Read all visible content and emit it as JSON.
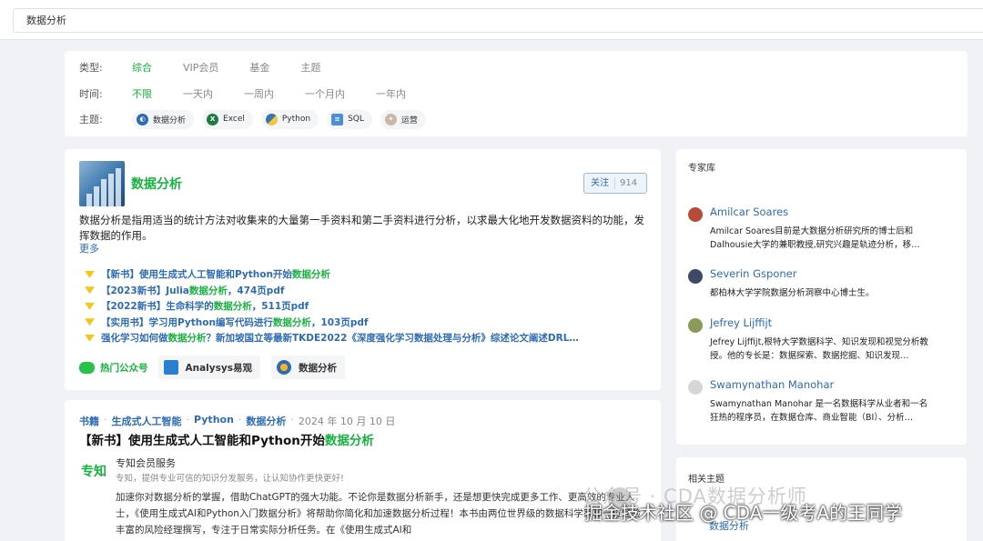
{
  "search": {
    "value": "数据分析"
  },
  "filters": {
    "type_label": "类型:",
    "type_options": [
      "综合",
      "VIP会员",
      "基金",
      "主题"
    ],
    "time_label": "时间:",
    "time_options": [
      "不限",
      "一天内",
      "一周内",
      "一个月内",
      "一年内"
    ],
    "topic_label": "主题:",
    "topics": [
      "数据分析",
      "Excel",
      "Python",
      "SQL",
      "运营"
    ]
  },
  "topic_card": {
    "title": "数据分析",
    "follow_label": "关注",
    "follow_count": "914",
    "description": "数据分析是指用适当的统计方法对收集来的大量第一手资料和第二手资料进行分析，以求最大化地开发数据资料的功能，发挥数据的作用。",
    "more": "更多",
    "links": [
      {
        "pre": "【新书】使用生成式人工智能和Python开始",
        "hl": "数据分析",
        "post": ""
      },
      {
        "pre": "【2023新书】Julia",
        "hl": "数据分析",
        "post": "，474页pdf"
      },
      {
        "pre": "【2022新书】生命科学的",
        "hl": "数据分析",
        "post": "，511页pdf"
      },
      {
        "pre": "【实用书】学习用Python编写代码进行",
        "hl": "数据分析",
        "post": "，103页pdf"
      },
      {
        "pre": "强化学习如何做",
        "hl": "数据分析",
        "post": "？新加坡国立等最新TKDE2022《深度强化学习数据处理与分析》综述论文阐述DRL…"
      }
    ],
    "promo": {
      "hot_label": "热门公众号",
      "account1": "Analysys易观",
      "account2": "数据分析"
    }
  },
  "article": {
    "crumbs": [
      "书籍",
      "生成式人工智能",
      "Python",
      "数据分析"
    ],
    "date": "2024 年 10 月 10 日",
    "title_pre": "【新书】使用生成式人工智能和Python开始",
    "title_hl": "数据分析",
    "source_logo": "专知",
    "source_name": "专知会员服务",
    "source_sub": "专知，提供专业可信的知识分发服务，让认知协作更快更好!",
    "body": "加速你对数据分析的掌握，借助ChatGPT的强大功能。不论你是数据分析新手，还是想更快完成更多工作、更高效的专业人士，《使用生成式AI和Python入门数据分析》将帮助你简化和加速数据分析过程！本书由两位世界级的数据科学家和一位经验丰富的风险经理撰写，专注于日常实际分析任务。在《使用生成式AI和"
  },
  "experts": {
    "heading": "专家库",
    "items": [
      {
        "name": "Amilcar Soares",
        "bio": "Amilcar Soares目前是大数据分析研究所的博士后和Dalhousie大学的兼职教授,研究兴趣是轨迹分析，移…",
        "avatar_color": "#b84a3a"
      },
      {
        "name": "Severin Gsponer",
        "bio": "都柏林大学学院数据分析洞察中心博士生。",
        "avatar_color": "#3d4a66"
      },
      {
        "name": "Jefrey Lijffijt",
        "bio": "Jefrey Lijffijt,根特大学数据科学、知识发现和视觉分析教授。他的专长是：数据探索、数据挖掘、知识发现…",
        "avatar_color": "#8a9a5b"
      },
      {
        "name": "Swamynathan Manohar",
        "bio": "Swamynathan Manohar 是一名数据科学从业者和一名狂热的程序员，在数据仓库、商业智能（BI）、分析…",
        "avatar_color": "#d6d6d6"
      }
    ]
  },
  "related": {
    "heading": "相关主题",
    "first": "数据分析"
  },
  "watermark": {
    "line1": "公众号 · CDA数据分析师",
    "line2": "掘金技术社区 @ CDA一级考A的王同学"
  }
}
